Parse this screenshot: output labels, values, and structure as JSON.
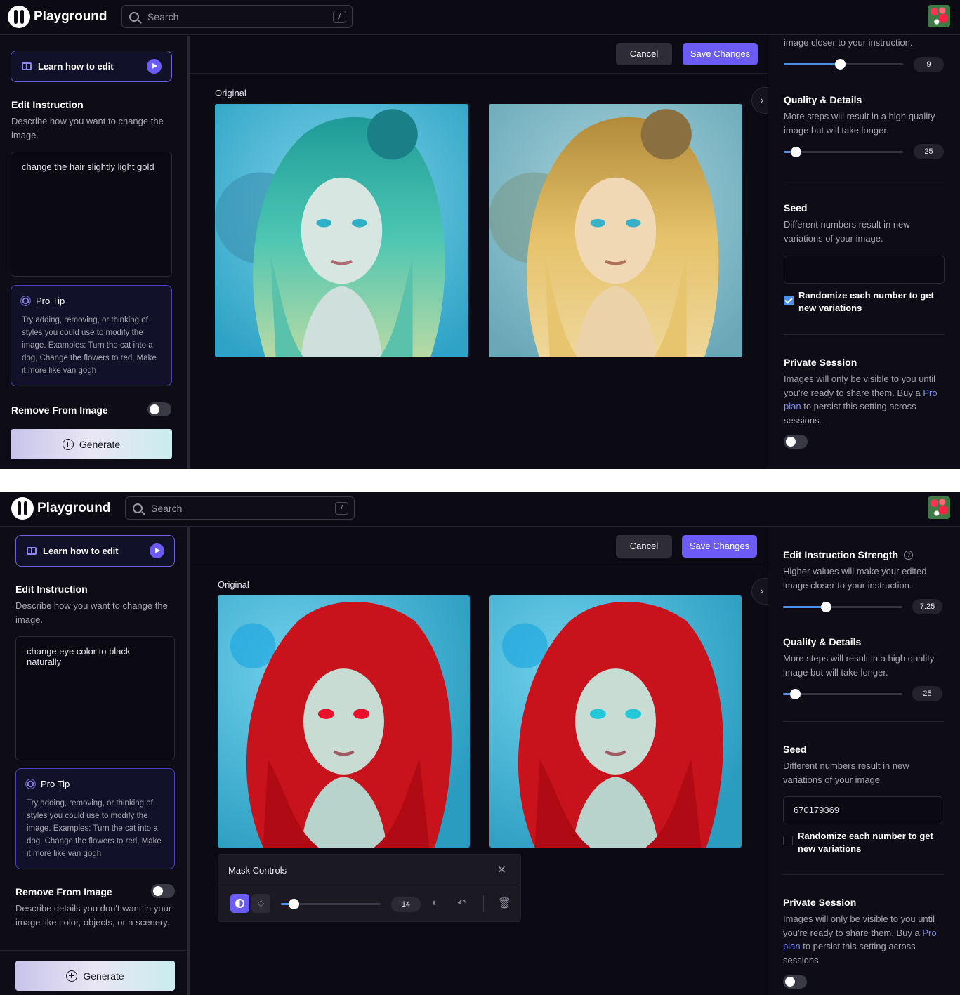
{
  "screens": [
    {
      "app": {
        "name": "Playground"
      },
      "search": {
        "placeholder": "Search",
        "shortcut": "/"
      },
      "sidebar": {
        "learn_label": "Learn how to edit",
        "edit_title": "Edit Instruction",
        "edit_desc": "Describe how you want to change the image.",
        "instruction": "change the hair slightly light gold",
        "protip_title": "Pro Tip",
        "protip_body": "Try adding, removing, or thinking of styles you could use to modify the image. Examples: Turn the cat into a dog, Change the flowers to red, Make it more like van gogh",
        "remove_title": "Remove From Image",
        "generate_label": "Generate"
      },
      "toolbar": {
        "cancel_label": "Cancel",
        "save_label": "Save Changes"
      },
      "canvas": {
        "original_label": "Original"
      },
      "right_panel": {
        "strength_desc_tail": "image closer to your instruction.",
        "strength_value": "9",
        "strength_fraction": 0.47,
        "quality_title": "Quality & Details",
        "quality_desc": "More steps will result in a high quality image but will take longer.",
        "quality_value": "25",
        "quality_fraction": 0.1,
        "seed_title": "Seed",
        "seed_desc": "Different numbers result in new variations of your image.",
        "seed_value": "",
        "randomize_label": "Randomize each number to get new variations",
        "randomize_checked": true,
        "private_title": "Private Session",
        "private_desc_1": "Images will only be visible to you until you're ready to share them. Buy a",
        "private_link": "Pro plan",
        "private_desc_2": "to persist this setting across sessions."
      }
    },
    {
      "app": {
        "name": "Playground"
      },
      "search": {
        "placeholder": "Search",
        "shortcut": "/"
      },
      "sidebar": {
        "learn_label": "Learn how to edit",
        "edit_title": "Edit Instruction",
        "edit_desc": "Describe how you want to change the image.",
        "instruction": "change eye color to black naturally",
        "protip_title": "Pro Tip",
        "protip_body": "Try adding, removing, or thinking of styles you could use to modify the image. Examples: Turn the cat into a dog, Change the flowers to red, Make it more like van gogh",
        "remove_title": "Remove From Image",
        "remove_desc": "Describe details you don't want in your image like color, objects, or a scenery.",
        "generate_label": "Generate"
      },
      "toolbar": {
        "cancel_label": "Cancel",
        "save_label": "Save Changes"
      },
      "canvas": {
        "original_label": "Original"
      },
      "mask_controls": {
        "title": "Mask Controls",
        "brush_value": "14"
      },
      "right_panel": {
        "strength_title": "Edit Instruction Strength",
        "strength_desc": "Higher values will make your edited image closer to your instruction.",
        "strength_value": "7.25",
        "strength_fraction": 0.36,
        "quality_title": "Quality & Details",
        "quality_desc": "More steps will result in a high quality image but will take longer.",
        "quality_value": "25",
        "quality_fraction": 0.1,
        "seed_title": "Seed",
        "seed_desc": "Different numbers result in new variations of your image.",
        "seed_value": "670179369",
        "randomize_label": "Randomize each number to get new variations",
        "randomize_checked": false,
        "private_title": "Private Session",
        "private_desc_1": "Images will only be visible to you until you're ready to share them. Buy a",
        "private_link": "Pro plan",
        "private_desc_2": "to persist this setting across sessions."
      }
    }
  ],
  "colors": {
    "accent": "#6b5cf5",
    "slider_fill": "#4d8fe8",
    "background": "#0c0b14",
    "hair_teal": "#3fb8a8",
    "hair_gold": "#e0b84f",
    "hair_red": "#d1121d",
    "sky_blue": "#3fb8d6"
  }
}
